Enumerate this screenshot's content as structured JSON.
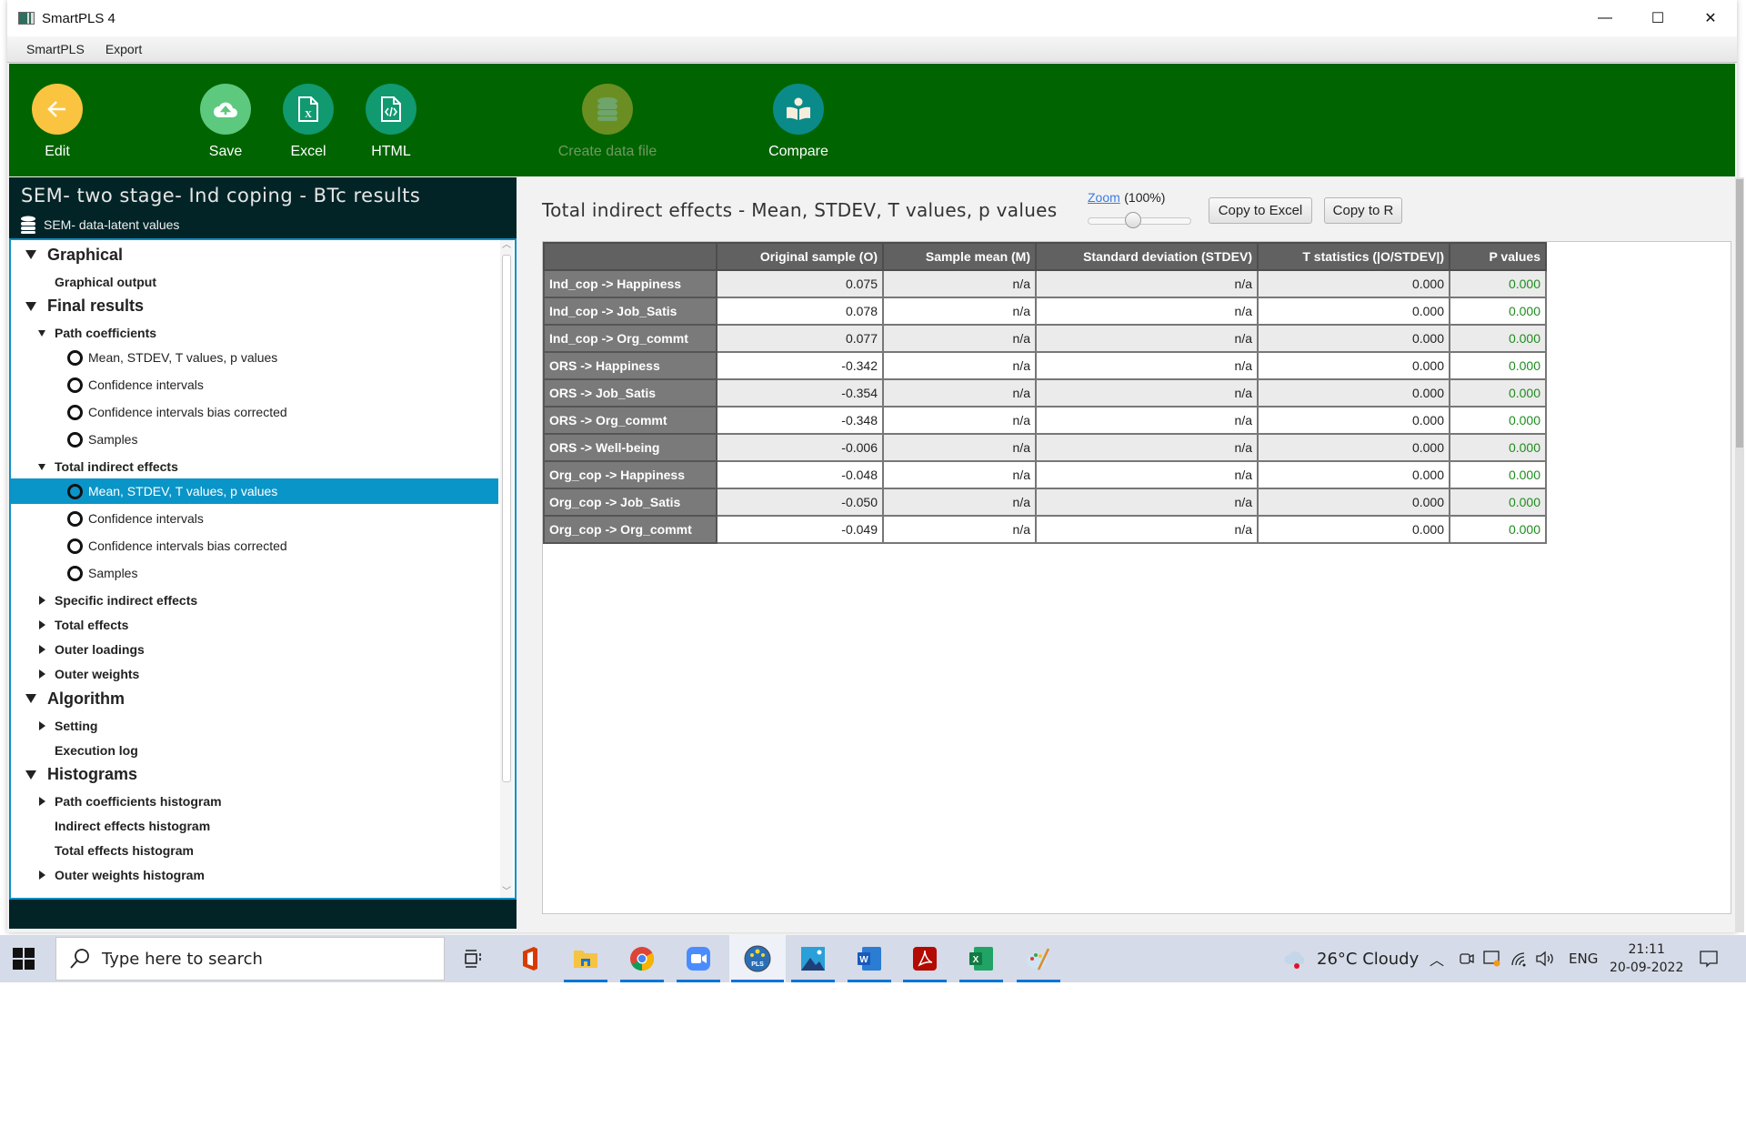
{
  "window": {
    "title": "SmartPLS 4",
    "controls": {
      "minimize": "—",
      "maximize": "☐",
      "close": "✕"
    }
  },
  "menu": [
    "SmartPLS",
    "Export"
  ],
  "toolbar": {
    "buttons": [
      {
        "label": "Edit",
        "icon": "arrow-left-icon",
        "color": "#fbc440",
        "enabled": true
      },
      {
        "label": "Save",
        "icon": "cloud-upload-icon",
        "color": "#5dc97e",
        "enabled": true
      },
      {
        "label": "Excel",
        "icon": "excel-file-icon",
        "color": "#119970",
        "enabled": true
      },
      {
        "label": "HTML",
        "icon": "html-file-icon",
        "color": "#119970",
        "enabled": true
      },
      {
        "label": "Create data file",
        "icon": "database-icon",
        "color": "#6b8e23",
        "enabled": false
      },
      {
        "label": "Compare",
        "icon": "reader-book-icon",
        "color": "#0b8a8a",
        "enabled": true
      }
    ]
  },
  "left_panel": {
    "title": "SEM- two stage- Ind coping - BTc results",
    "dataset": "SEM- data-latent values",
    "tree": [
      {
        "label": "Graphical",
        "level": 0,
        "toggle": "expanded"
      },
      {
        "label": "Graphical output",
        "level": 1,
        "toggle": "none"
      },
      {
        "label": "Final results",
        "level": 0,
        "toggle": "expanded"
      },
      {
        "label": "Path coefficients",
        "level": 1,
        "toggle": "expanded"
      },
      {
        "label": "Mean, STDEV, T values, p values",
        "level": 2,
        "toggle": "radio"
      },
      {
        "label": "Confidence intervals",
        "level": 2,
        "toggle": "radio"
      },
      {
        "label": "Confidence intervals bias corrected",
        "level": 2,
        "toggle": "radio"
      },
      {
        "label": "Samples",
        "level": 2,
        "toggle": "radio"
      },
      {
        "label": "Total indirect effects",
        "level": 1,
        "toggle": "expanded"
      },
      {
        "label": "Mean, STDEV, T values, p values",
        "level": 2,
        "toggle": "radio",
        "selected": true
      },
      {
        "label": "Confidence intervals",
        "level": 2,
        "toggle": "radio"
      },
      {
        "label": "Confidence intervals bias corrected",
        "level": 2,
        "toggle": "radio"
      },
      {
        "label": "Samples",
        "level": 2,
        "toggle": "radio"
      },
      {
        "label": "Specific indirect effects",
        "level": 1,
        "toggle": "collapsed"
      },
      {
        "label": "Total effects",
        "level": 1,
        "toggle": "collapsed"
      },
      {
        "label": "Outer loadings",
        "level": 1,
        "toggle": "collapsed"
      },
      {
        "label": "Outer weights",
        "level": 1,
        "toggle": "collapsed"
      },
      {
        "label": "Algorithm",
        "level": 0,
        "toggle": "expanded"
      },
      {
        "label": "Setting",
        "level": 1,
        "toggle": "collapsed"
      },
      {
        "label": "Execution log",
        "level": 1,
        "toggle": "none"
      },
      {
        "label": "Histograms",
        "level": 0,
        "toggle": "expanded"
      },
      {
        "label": "Path coefficients histogram",
        "level": 1,
        "toggle": "collapsed"
      },
      {
        "label": "Indirect effects histogram",
        "level": 1,
        "toggle": "none"
      },
      {
        "label": "Total effects histogram",
        "level": 1,
        "toggle": "none"
      },
      {
        "label": "Outer weights histogram",
        "level": 1,
        "toggle": "collapsed"
      }
    ]
  },
  "main": {
    "title": "Total indirect effects - Mean, STDEV, T values, p values",
    "zoom_link": "Zoom",
    "zoom_value": "(100%)",
    "zoom_level_percent": 100,
    "copy_excel": "Copy to Excel",
    "copy_r": "Copy to R",
    "table": {
      "columns": [
        "",
        "Original sample (O)",
        "Sample mean (M)",
        "Standard deviation (STDEV)",
        "T statistics (|O/STDEV|)",
        "P values"
      ],
      "rows": [
        [
          "Ind_cop -> Happiness",
          "0.075",
          "n/a",
          "n/a",
          "0.000",
          "0.000"
        ],
        [
          "Ind_cop -> Job_Satis",
          "0.078",
          "n/a",
          "n/a",
          "0.000",
          "0.000"
        ],
        [
          "Ind_cop -> Org_commt",
          "0.077",
          "n/a",
          "n/a",
          "0.000",
          "0.000"
        ],
        [
          "ORS -> Happiness",
          "-0.342",
          "n/a",
          "n/a",
          "0.000",
          "0.000"
        ],
        [
          "ORS -> Job_Satis",
          "-0.354",
          "n/a",
          "n/a",
          "0.000",
          "0.000"
        ],
        [
          "ORS -> Org_commt",
          "-0.348",
          "n/a",
          "n/a",
          "0.000",
          "0.000"
        ],
        [
          "ORS -> Well-being",
          "-0.006",
          "n/a",
          "n/a",
          "0.000",
          "0.000"
        ],
        [
          "Org_cop -> Happiness",
          "-0.048",
          "n/a",
          "n/a",
          "0.000",
          "0.000"
        ],
        [
          "Org_cop -> Job_Satis",
          "-0.050",
          "n/a",
          "n/a",
          "0.000",
          "0.000"
        ],
        [
          "Org_cop -> Org_commt",
          "-0.049",
          "n/a",
          "n/a",
          "0.000",
          "0.000"
        ]
      ],
      "pvalue_color": "#1e8c1e"
    }
  },
  "taskbar": {
    "search_placeholder": "Type here to search",
    "apps": [
      "task-view",
      "office",
      "file-explorer",
      "chrome",
      "zoom",
      "smartpls",
      "photos",
      "word",
      "acrobat",
      "excel",
      "paint"
    ],
    "weather": "26°C  Cloudy",
    "language": "ENG",
    "time": "21:11",
    "date": "20-09-2022"
  },
  "colors": {
    "toolbar_green": "#006400",
    "panel_dark": "#022427",
    "selection_blue": "#0a95c8"
  }
}
